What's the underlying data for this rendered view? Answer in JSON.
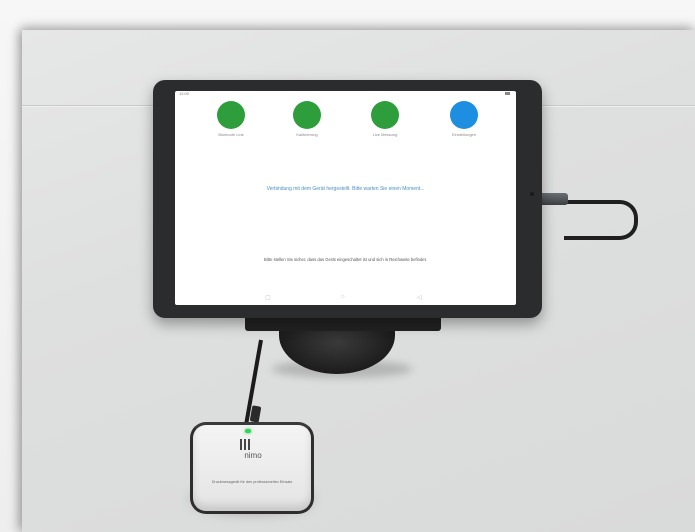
{
  "photo": {
    "description_colors": {
      "background": "#dedfdf",
      "tablet_bezel": "#2b2c2e",
      "screen": "#ffffff"
    }
  },
  "tablet": {
    "status_time": "12:00",
    "app_buttons": [
      {
        "label": "Bluetooth Link",
        "color": "#2e9e3c"
      },
      {
        "label": "Kalibrierung",
        "color": "#2e9e3c"
      },
      {
        "label": "Live Messung",
        "color": "#2e9e3c"
      },
      {
        "label": "Einstellungen",
        "color": "#1d8ee0"
      }
    ],
    "message": "Verbindung mit dem Gerät hergestellt. Bitte warten Sie einen Moment...",
    "footer_text": "Bitte stellen Sie sicher, dass das Gerät eingeschaltet ist und sich in Reichweite befindet.",
    "nav": {
      "back": "◁",
      "home": "○",
      "recents": "▢"
    }
  },
  "device": {
    "brand": "nimo",
    "caption": "Druckmessgerät für den professionellen Einsatz"
  }
}
